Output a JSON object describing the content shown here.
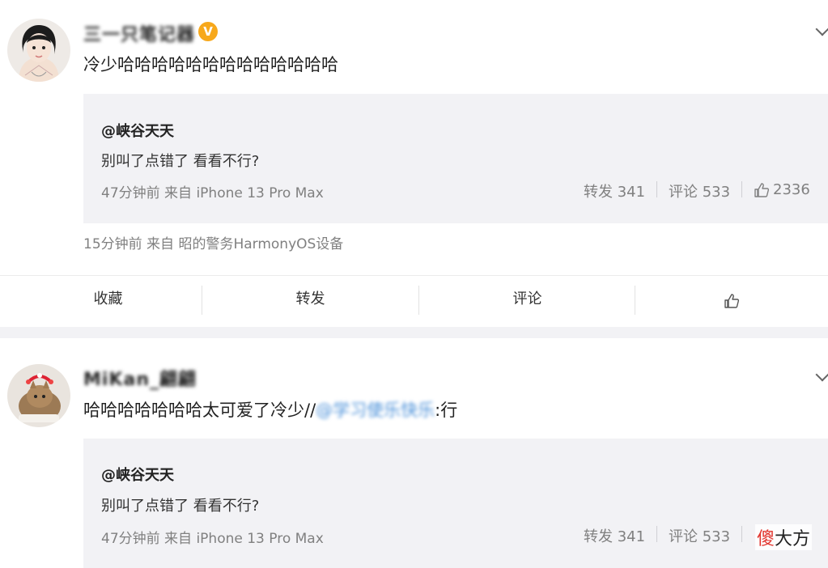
{
  "feed": {
    "posts": [
      {
        "username": "三一只笔记器",
        "verified_badge": "V",
        "text": "冷少哈哈哈哈哈哈哈哈哈哈哈哈哈",
        "quote": {
          "author": "@峡谷天天",
          "text": "别叫了点错了 看看不行?",
          "meta": "47分钟前 来自 iPhone 13 Pro Max",
          "repost": "转发 341",
          "comment": "评论 533",
          "likes": "2336"
        },
        "meta": "15分钟前  来自 昭的警务HarmonyOS设备",
        "actions": {
          "favorite": "收藏",
          "repost": "转发",
          "comment": "评论"
        }
      },
      {
        "username": "MiKan_翩翩",
        "text_before": "哈哈哈哈哈哈哈太可爱了冷少//",
        "mention": "@学习使乐快乐",
        "text_after": ":行",
        "quote": {
          "author": "@峡谷天天",
          "text": "别叫了点错了 看看不行?",
          "meta": "47分钟前 来自 iPhone 13 Pro Max",
          "repost": "转发 341",
          "comment": "评论 533"
        }
      }
    ]
  },
  "watermark": {
    "first_char": "傻",
    "rest": "大方"
  },
  "icons": {
    "like": "thumbs-up-icon",
    "menu": "chevron-down-icon",
    "verified": "verified-badge-icon"
  },
  "colors": {
    "mention": "#4a90d9",
    "verified": "#f7a81b",
    "quote_bg": "#f2f2f5"
  }
}
